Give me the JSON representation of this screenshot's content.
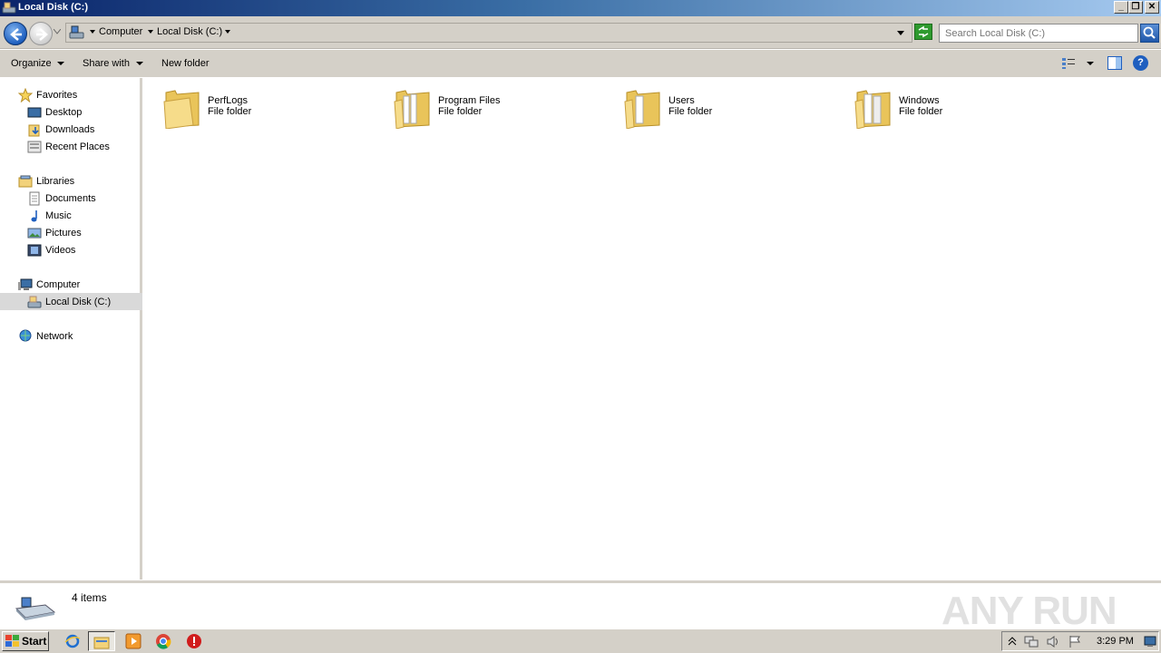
{
  "window": {
    "title": "Local Disk (C:)",
    "minimize_label": "_",
    "restore_label": "❐",
    "close_label": "✕"
  },
  "address": {
    "crumbs": [
      "Computer",
      "Local Disk (C:)"
    ],
    "search_placeholder": "Search Local Disk (C:)"
  },
  "toolbar": {
    "organize": "Organize",
    "share_with": "Share with",
    "new_folder": "New folder",
    "help": "?"
  },
  "nav": {
    "favorites": "Favorites",
    "desktop": "Desktop",
    "downloads": "Downloads",
    "recent_places": "Recent Places",
    "libraries": "Libraries",
    "documents": "Documents",
    "music": "Music",
    "pictures": "Pictures",
    "videos": "Videos",
    "computer": "Computer",
    "local_disk": "Local Disk (C:)",
    "network": "Network"
  },
  "folders": [
    {
      "name": "PerfLogs",
      "type": "File folder"
    },
    {
      "name": "Program Files",
      "type": "File folder"
    },
    {
      "name": "Users",
      "type": "File folder"
    },
    {
      "name": "Windows",
      "type": "File folder"
    }
  ],
  "details": {
    "item_count": "4 items"
  },
  "watermark": "ANY RUN",
  "taskbar": {
    "start": "Start",
    "clock": "3:29 PM"
  },
  "colors": {
    "titlebar_start": "#0a246a",
    "titlebar_end": "#a6caf0",
    "chrome": "#d4d0c8",
    "selected_nav": "#d9d9d9",
    "folder": "#f2d27a"
  }
}
